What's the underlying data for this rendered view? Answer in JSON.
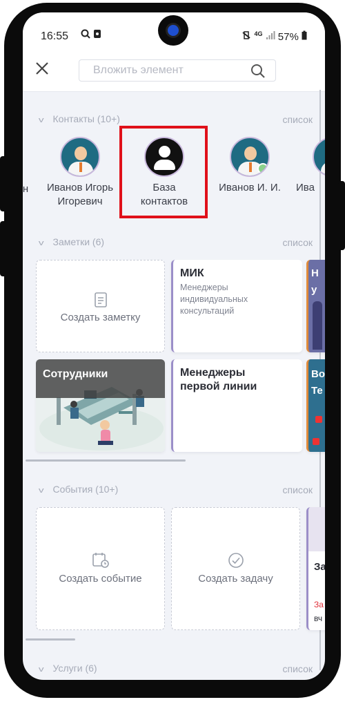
{
  "status": {
    "time": "16:55",
    "network": "4G",
    "battery": "57%"
  },
  "search": {
    "placeholder": "Вложить элемент"
  },
  "contacts": {
    "header": "Контакты (10+)",
    "link": "список",
    "partial_left": "н",
    "items": [
      {
        "name": "Иванов Игорь Игоревич"
      },
      {
        "name": "База контактов"
      },
      {
        "name": "Иванов И. И."
      },
      {
        "name": "Ива"
      }
    ]
  },
  "notes": {
    "header": "Заметки (6)",
    "link": "список",
    "create_label": "Создать заметку",
    "cards": [
      {
        "title": "МИК",
        "subtitle": "Менеджеры индивидуальных консультаций"
      },
      {
        "title": "Сотрудники"
      },
      {
        "title": "Менеджеры первой линии"
      }
    ],
    "partial_cards": [
      {
        "text": "Н у"
      },
      {
        "text": "Во Те"
      }
    ]
  },
  "events": {
    "header": "События (10+)",
    "link": "список",
    "create_event": "Создать событие",
    "create_task": "Создать задачу",
    "partial_card": {
      "line1": "За",
      "line2": "За",
      "line3": "вч"
    }
  },
  "services": {
    "header": "Услуги (6)",
    "link": "список"
  },
  "colors": {
    "accent": "#9b8ec8",
    "highlight": "#e0101a",
    "avatar_bg": "#1f6b82"
  }
}
